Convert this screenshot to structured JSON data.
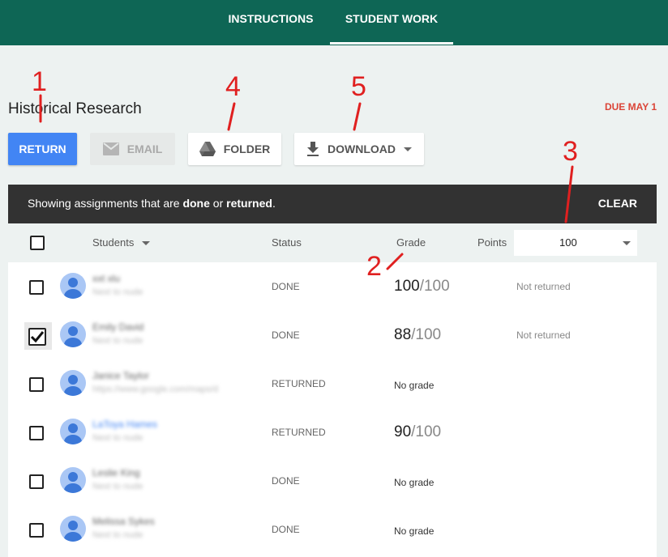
{
  "tabs": [
    {
      "label": "INSTRUCTIONS"
    },
    {
      "label": "STUDENT WORK"
    }
  ],
  "assignment": {
    "title": "Historical Research",
    "due": "DUE MAY 1"
  },
  "toolbar": {
    "return_label": "RETURN",
    "email_label": "EMAIL",
    "folder_label": "FOLDER",
    "download_label": "DOWNLOAD"
  },
  "filter_bar": {
    "prefix": "Showing assignments that are ",
    "term1": "done",
    "joiner": " or ",
    "term2": "returned",
    "suffix": ".",
    "clear_label": "CLEAR"
  },
  "table_header": {
    "students": "Students",
    "status": "Status",
    "grade": "Grade",
    "points_label": "Points",
    "points_value": "100"
  },
  "rows": [
    {
      "name": "xxt xlu",
      "sub": "Next to nude",
      "status": "DONE",
      "grade_num": "100",
      "grade_den": "/100",
      "no_grade": "",
      "return_state": "Not returned",
      "checked": false
    },
    {
      "name": "Emily David",
      "sub": "Next to nude",
      "status": "DONE",
      "grade_num": "88",
      "grade_den": "/100",
      "no_grade": "",
      "return_state": "Not returned",
      "checked": true
    },
    {
      "name": "Janice Taylor",
      "sub": "https://www.google.com/maps/d",
      "status": "RETURNED",
      "grade_num": "",
      "grade_den": "",
      "no_grade": "No grade",
      "return_state": "",
      "checked": false
    },
    {
      "name": "LaToya Hames",
      "sub": "Next to nude",
      "status": "RETURNED",
      "grade_num": "90",
      "grade_den": "/100",
      "no_grade": "",
      "return_state": "",
      "checked": false
    },
    {
      "name": "Leslie King",
      "sub": "Next to nude",
      "status": "DONE",
      "grade_num": "",
      "grade_den": "",
      "no_grade": "No grade",
      "return_state": "",
      "checked": false
    },
    {
      "name": "Melissa Sykes",
      "sub": "Next to nude",
      "status": "DONE",
      "grade_num": "",
      "grade_den": "",
      "no_grade": "No grade",
      "return_state": "",
      "checked": false
    }
  ],
  "annotations": [
    "1",
    "2",
    "3",
    "4",
    "5"
  ],
  "colors": {
    "topbar": "#0e6655",
    "return_button": "#4285f4",
    "due": "#db4437",
    "annotation": "#e02020"
  }
}
